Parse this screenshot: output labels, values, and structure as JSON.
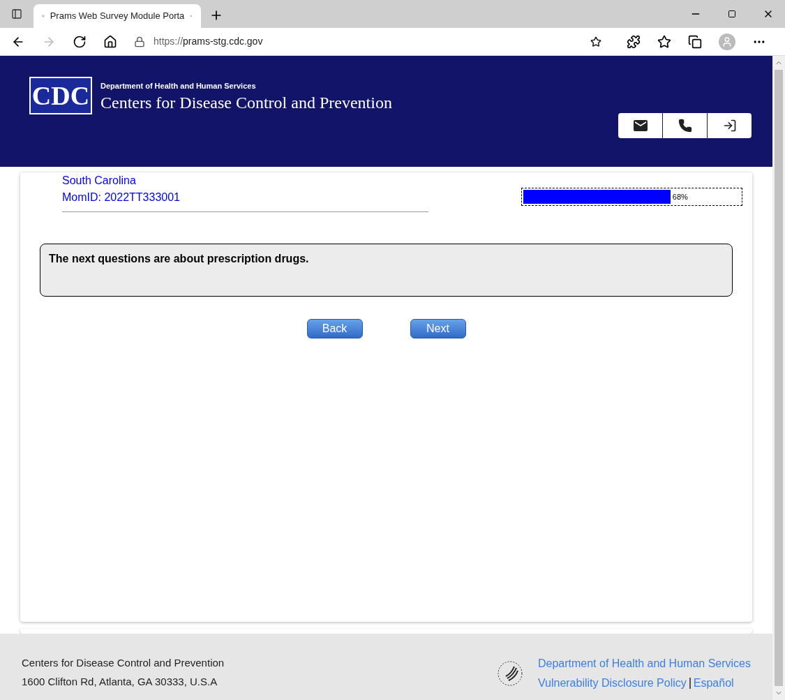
{
  "browser": {
    "tab_title": "Prams Web Survey Module Porta",
    "url_prefix": "https://",
    "url_host": "prams-stg.cdc.gov"
  },
  "header": {
    "logo_text": "CDC",
    "department": "Department of Health and Human Services",
    "agency": "Centers for Disease Control and Prevention"
  },
  "respondent": {
    "state": "South Carolina",
    "mom_id": "MomID: 2022TT333001"
  },
  "progress": {
    "level": 0.68,
    "reading": "68%"
  },
  "question": {
    "text": "The next questions are about prescription drugs."
  },
  "buttons": [
    {
      "label": "Back"
    },
    {
      "label": "Next"
    }
  ],
  "footer": {
    "org": "Centers for Disease Control and Prevention",
    "address": "1600 Clifton Rd, Atlanta, GA 30333, U.S.A",
    "links": [
      {
        "label": "Department of Health and Human Services"
      },
      {
        "label": "Vulnerability Disclosure Policy"
      },
      {
        "label": "Español"
      }
    ]
  }
}
